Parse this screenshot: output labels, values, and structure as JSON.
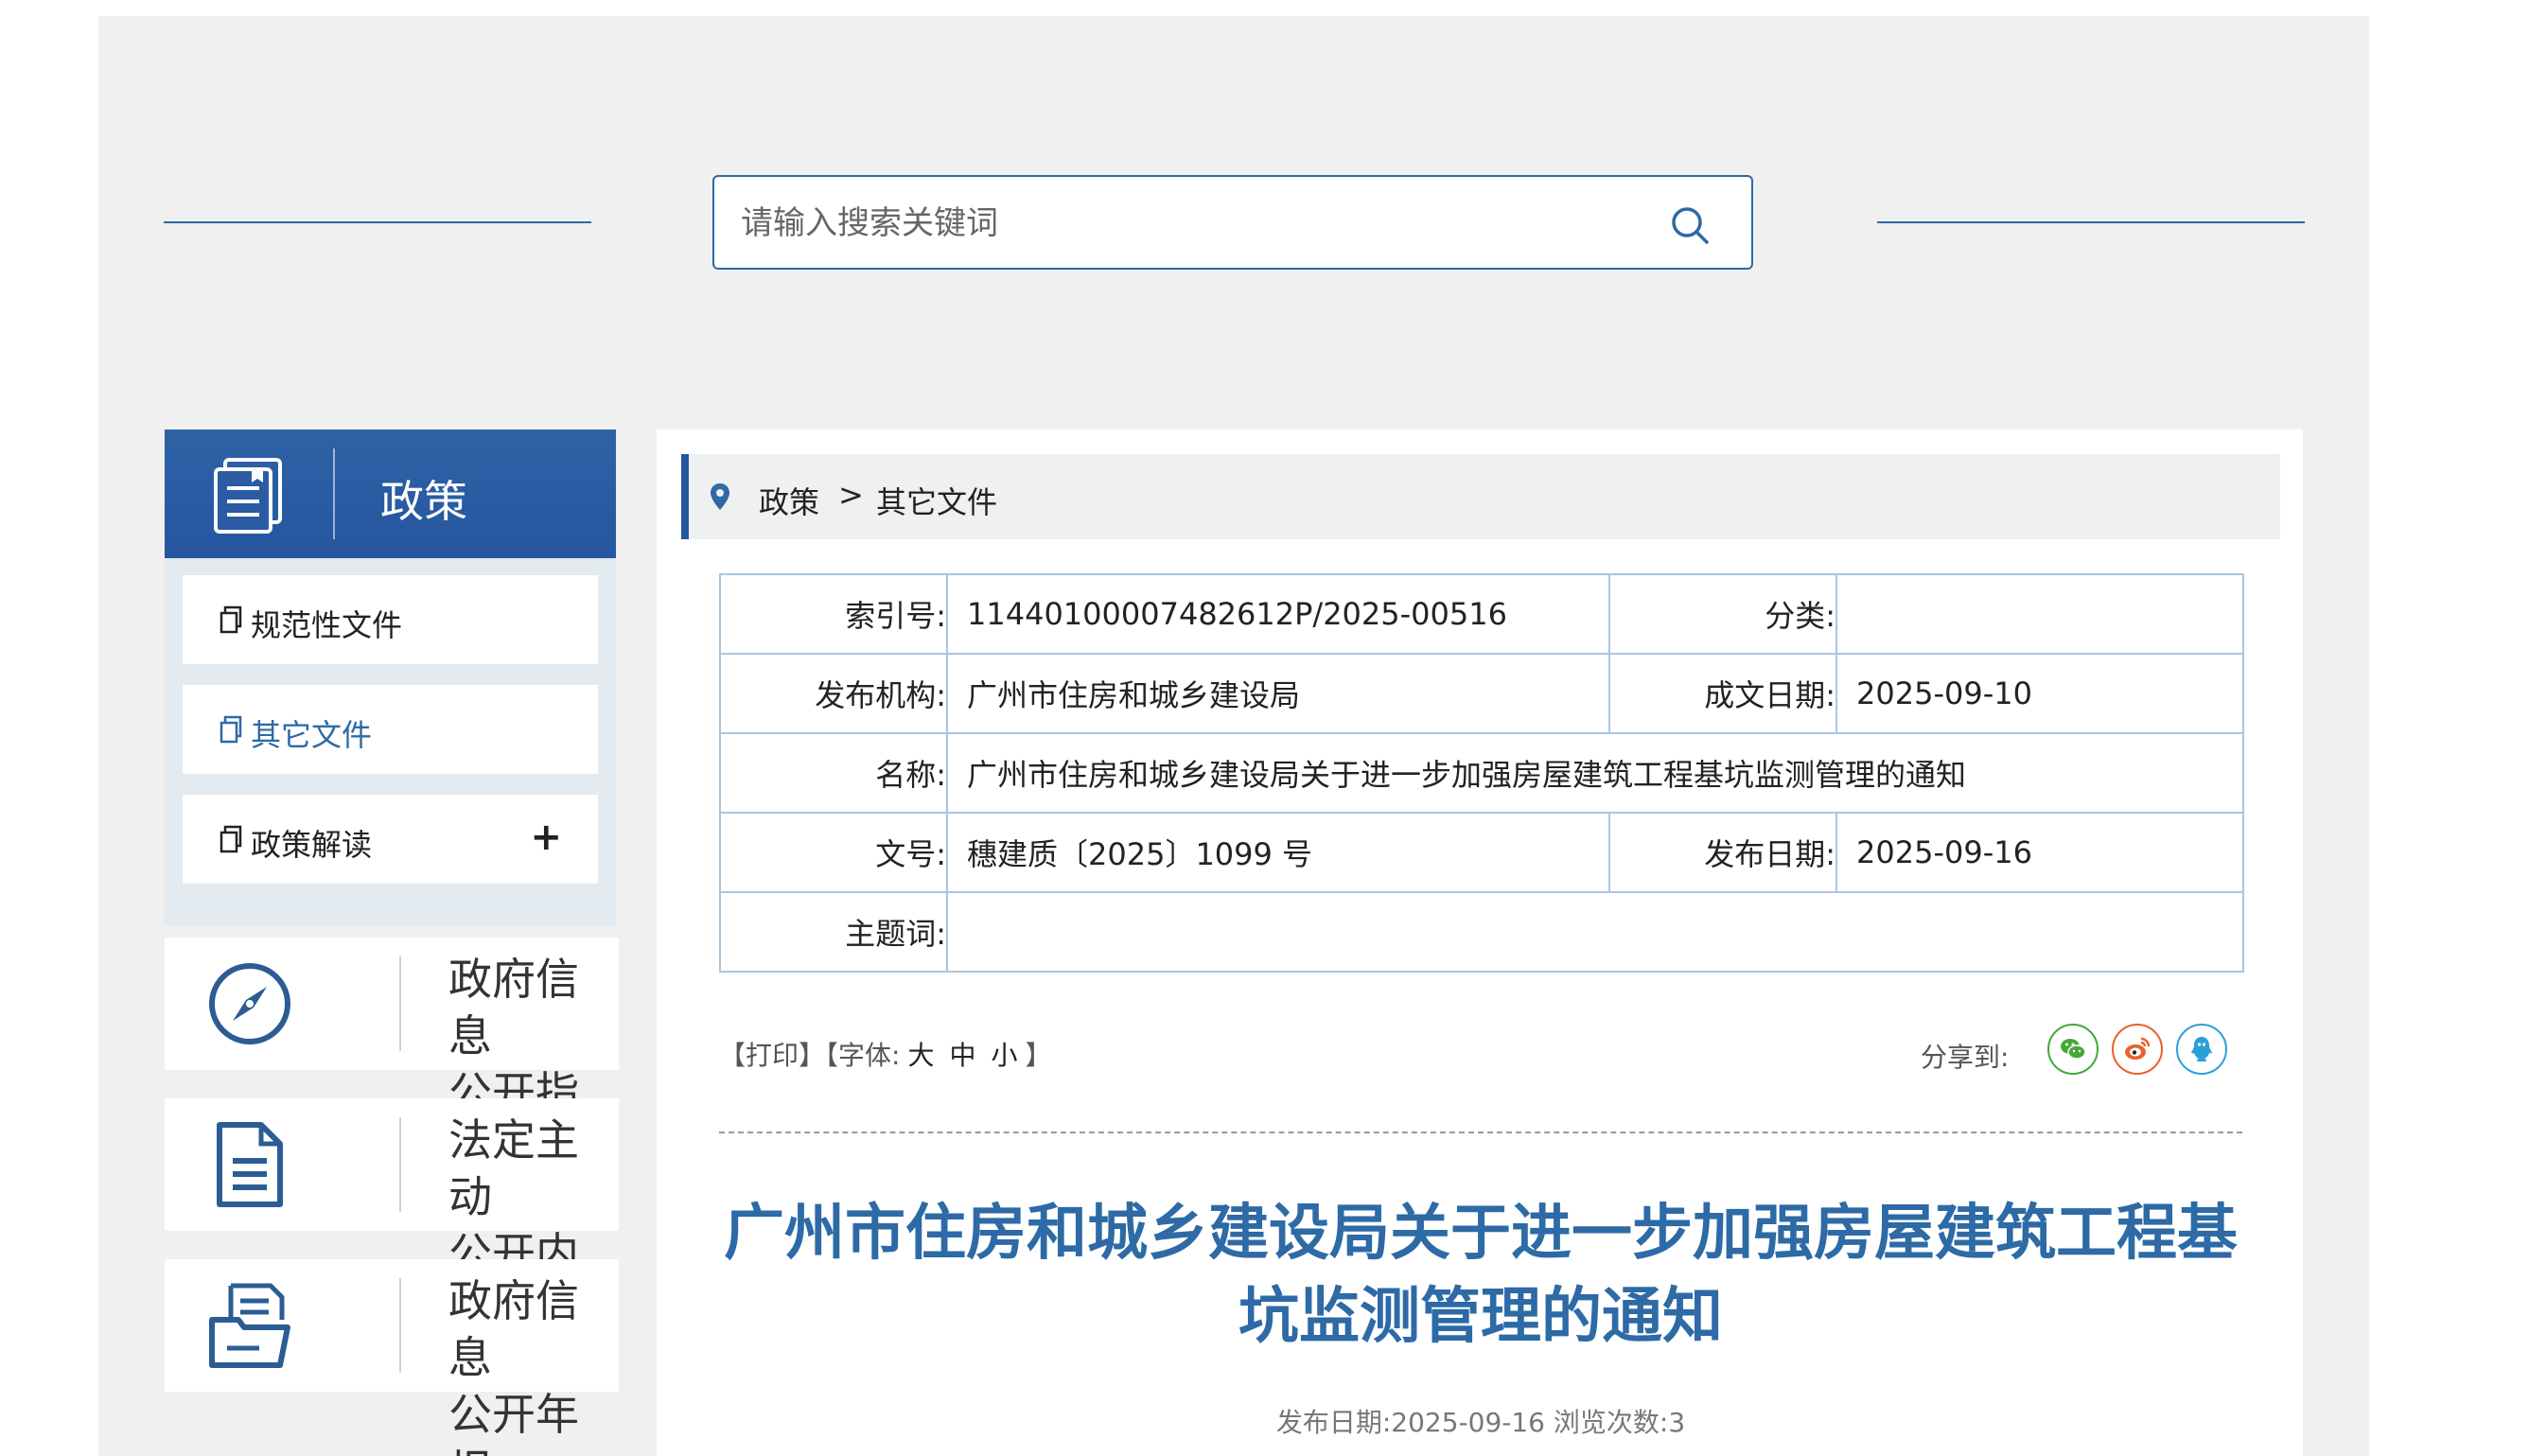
{
  "search": {
    "placeholder": "请输入搜索关键词"
  },
  "sidebar": {
    "header_title": "政策",
    "items": [
      {
        "label": "规范性文件",
        "active": false
      },
      {
        "label": "其它文件",
        "active": true
      },
      {
        "label": "政策解读",
        "active": false,
        "expand": "+"
      }
    ],
    "cards": [
      {
        "text": "政府信息\n公开指南",
        "icon": "compass-icon"
      },
      {
        "text": "法定主动\n公开内容",
        "icon": "document-icon"
      },
      {
        "text": "政府信息\n公开年报",
        "icon": "folder-icon"
      }
    ]
  },
  "breadcrumb": {
    "level1": "政策",
    "separator": ">",
    "level2": "其它文件"
  },
  "meta": {
    "index_label": "索引号:",
    "index_value": "11440100007482612P/2025-00516",
    "category_label": "分类:",
    "category_value": "",
    "publisher_label": "发布机构:",
    "publisher_value": "广州市住房和城乡建设局",
    "created_label": "成文日期:",
    "created_value": "2025-09-10",
    "name_label": "名称:",
    "name_value": "广州市住房和城乡建设局关于进一步加强房屋建筑工程基坑监测管理的通知",
    "docno_label": "文号:",
    "docno_value": "穗建质〔2025〕1099 号",
    "pubdate_label": "发布日期:",
    "pubdate_value": "2025-09-16",
    "subject_label": "主题词:",
    "subject_value": ""
  },
  "tools": {
    "print": "【打印】",
    "font_prefix": "【字体:",
    "font_large": "大",
    "font_medium": "中",
    "font_small": "小",
    "font_suffix": "】",
    "share_label": "分享到:"
  },
  "share": [
    {
      "name": "wechat",
      "color": "#44a838"
    },
    {
      "name": "weibo",
      "color": "#e8622c"
    },
    {
      "name": "qq",
      "color": "#2d9fd8"
    }
  ],
  "article": {
    "title": "广州市住房和城乡建设局关于进一步加强房屋建筑工程基坑监测管理的通知",
    "pubinfo": "发布日期:2025-09-16  浏览次数:3"
  },
  "colors": {
    "accent": "#2d6aa6",
    "header_bg": "#2556a0",
    "page_bg": "#f0f0f0"
  }
}
